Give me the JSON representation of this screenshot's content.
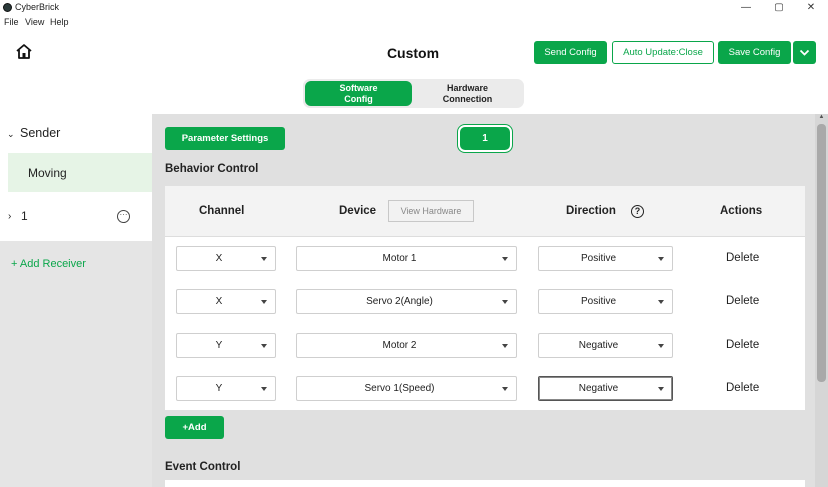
{
  "window": {
    "title": "CyberBrick",
    "controls": [
      "—",
      "▢",
      "✕"
    ]
  },
  "menu": {
    "items": [
      "File",
      "View",
      "Help"
    ]
  },
  "header": {
    "title": "Custom",
    "send_config": "Send Config",
    "auto_update": "Auto Update:Close",
    "save_config": "Save Config"
  },
  "config_tabs": {
    "software": [
      "Software",
      "Config"
    ],
    "hardware": [
      "Hardware",
      "Connection"
    ]
  },
  "sidebar": {
    "sender_label": "Sender",
    "moving_label": "Moving",
    "receiver_label": "1",
    "add_receiver": "+ Add Receiver"
  },
  "main": {
    "parameter_settings": "Parameter Settings",
    "receiver_pill": "1",
    "behavior_title": "Behavior Control",
    "event_title": "Event Control",
    "add_button": "+Add",
    "headers": {
      "channel": "Channel",
      "device": "Device",
      "view_hardware": "View Hardware",
      "direction": "Direction",
      "actions": "Actions"
    },
    "help_glyph": "?",
    "rows": [
      {
        "channel": "X",
        "device": "Motor 1",
        "direction": "Positive",
        "action": "Delete"
      },
      {
        "channel": "X",
        "device": "Servo 2(Angle)",
        "direction": "Positive",
        "action": "Delete"
      },
      {
        "channel": "Y",
        "device": "Motor 2",
        "direction": "Negative",
        "action": "Delete"
      },
      {
        "channel": "Y",
        "device": "Servo 1(Speed)",
        "direction": "Negative",
        "action": "Delete"
      }
    ]
  },
  "colors": {
    "accent": "#0aa64a",
    "selected_bg": "#e6f4e6",
    "panel_bg": "#e0e0e0"
  },
  "icons": {
    "home": "home-icon",
    "more": "more-options-icon",
    "help": "help-circle-icon",
    "dropdown": "chevron-down-icon"
  }
}
